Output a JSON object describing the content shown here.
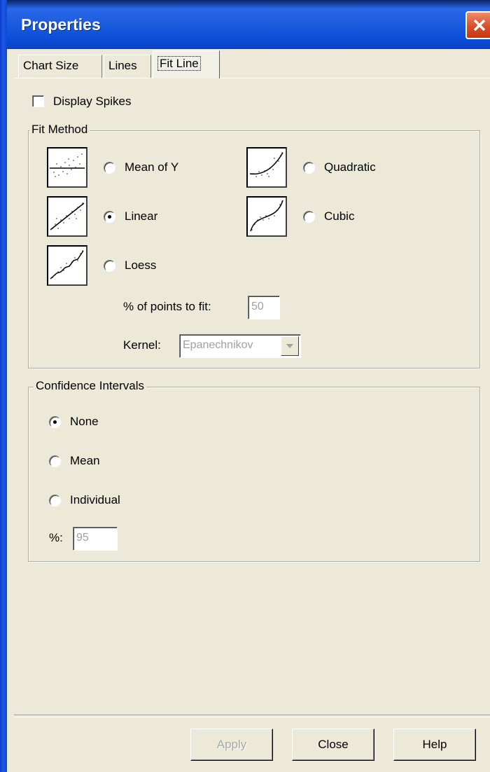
{
  "window": {
    "title": "Properties"
  },
  "tabs": [
    {
      "label": "Chart Size"
    },
    {
      "label": "Lines"
    },
    {
      "label": "Fit Line"
    }
  ],
  "display_spikes": {
    "label": "Display Spikes",
    "checked": false
  },
  "fit_method": {
    "title": "Fit Method",
    "options": [
      {
        "label": "Mean of Y",
        "selected": false,
        "icon": "mean-of-y-plot-icon"
      },
      {
        "label": "Quadratic",
        "selected": false,
        "icon": "quadratic-plot-icon"
      },
      {
        "label": "Linear",
        "selected": true,
        "icon": "linear-plot-icon"
      },
      {
        "label": "Cubic",
        "selected": false,
        "icon": "cubic-plot-icon"
      },
      {
        "label": "Loess",
        "selected": false,
        "icon": "loess-plot-icon"
      }
    ],
    "points_label": "% of points to fit:",
    "points_value": "50",
    "kernel_label": "Kernel:",
    "kernel_value": "Epanechnikov"
  },
  "confidence_intervals": {
    "title": "Confidence Intervals",
    "options": [
      {
        "label": "None",
        "selected": true
      },
      {
        "label": "Mean",
        "selected": false
      },
      {
        "label": "Individual",
        "selected": false
      }
    ],
    "percent_label": "%:",
    "percent_value": "95"
  },
  "buttons": {
    "apply": "Apply",
    "close": "Close",
    "help": "Help"
  }
}
